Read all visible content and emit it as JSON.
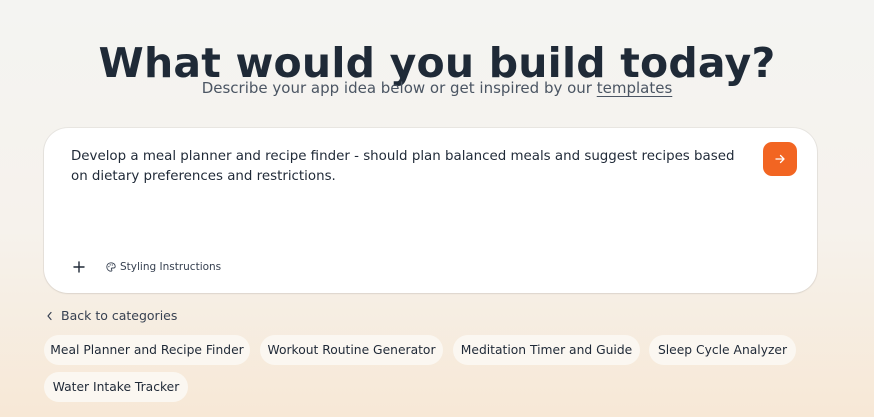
{
  "heading": "What would you build today?",
  "subheading": {
    "text": "Describe your app idea below or get inspired by our",
    "link": "templates"
  },
  "prompt": {
    "text": "Develop a meal planner and recipe finder - should plan balanced meals and suggest recipes based on dietary preferences and restrictions.",
    "send_icon": "arrow-right-icon",
    "add_icon": "plus-icon",
    "styling_icon": "palette-icon",
    "styling_label": "Styling Instructions"
  },
  "back_link": {
    "icon": "chevron-left-icon",
    "label": "Back to categories"
  },
  "suggestions": [
    "Meal Planner and Recipe Finder",
    "Workout Routine Generator",
    "Meditation Timer and Guide",
    "Sleep Cycle Analyzer",
    "Water Intake Tracker"
  ],
  "colors": {
    "accent": "#f26522",
    "heading": "#1f2a37",
    "chip_background": "#fbf7f1",
    "card_background": "#ffffff"
  }
}
